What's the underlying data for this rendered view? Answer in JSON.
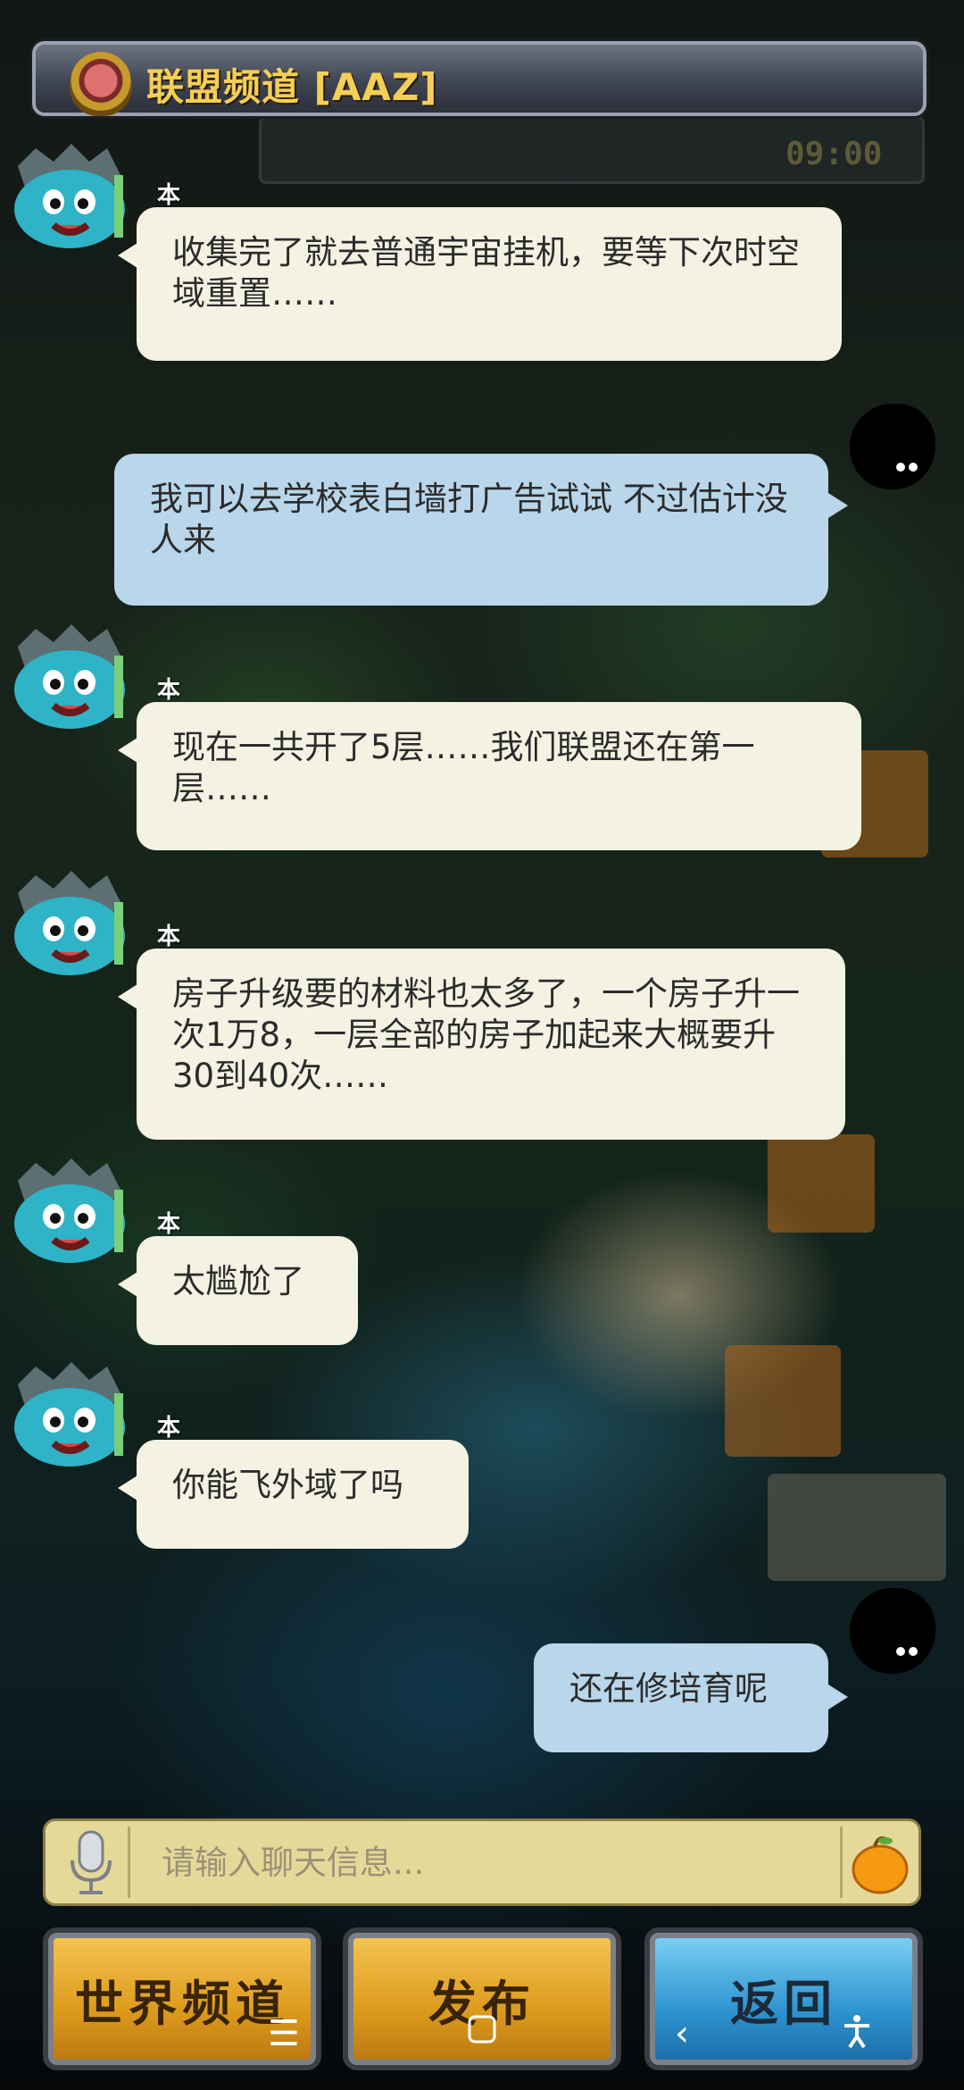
{
  "header": {
    "title": "联盟频道 [AAZ]",
    "badge_icon": "alliance-badge-icon"
  },
  "background": {
    "timer": "09:00"
  },
  "messages": [
    {
      "side": "left",
      "sender": "本名非我",
      "text": "收集完了就去普通宇宙挂机，要等下次时空域重置……"
    },
    {
      "side": "right",
      "text": "我可以去学校表白墙打广告试试 不过估计没人来"
    },
    {
      "side": "left",
      "sender": "本名非我",
      "text": "现在一共开了5层……我们联盟还在第一层……"
    },
    {
      "side": "left",
      "sender": "本名非我",
      "text": "房子升级要的材料也太多了，一个房子升一次1万8，一层全部的房子加起来大概要升30到40次……"
    },
    {
      "side": "left",
      "sender": "本名非我",
      "text": "太尴尬了"
    },
    {
      "side": "left",
      "sender": "本名非我",
      "text": "你能飞外域了吗"
    },
    {
      "side": "right",
      "text": "还在修培育呢"
    }
  ],
  "input": {
    "placeholder": "请输入聊天信息...",
    "value": "",
    "mic_icon": "microphone-icon",
    "emoji_icon": "emoji-icon"
  },
  "buttons": {
    "world": "世界频道",
    "publish": "发布",
    "back": "返回"
  },
  "system_nav": {
    "menu_icon": "menu-icon",
    "home_icon": "home-icon",
    "back_icon": "back-icon",
    "accessibility_icon": "accessibility-icon"
  },
  "colors": {
    "title": "#f3cf55",
    "bubble_left": "#f4f2e3",
    "bubble_right": "#b9d6ea",
    "button_gold": "#dc9a1c",
    "button_blue": "#2d93cf"
  }
}
